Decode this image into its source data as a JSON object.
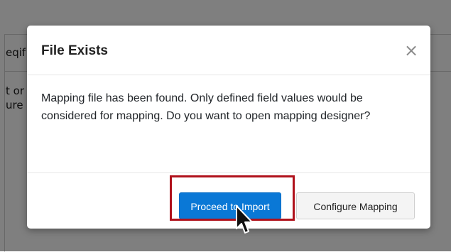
{
  "background": {
    "fragment_1": "eqif",
    "fragment_2": "t or",
    "fragment_3": "ure l"
  },
  "dialog": {
    "title": "File Exists",
    "close_symbol": "×",
    "message": "Mapping file has been found. Only defined field values would be considered for mapping. Do you want to open mapping designer?",
    "primary_button": "Proceed to Import",
    "secondary_button": "Configure Mapping"
  },
  "colors": {
    "primary": "#0a78d6",
    "highlight": "#b0111b",
    "overlay": "rgba(0,0,0,0.5)"
  },
  "icons": {
    "close": "close-icon",
    "cursor": "mouse-pointer-icon"
  }
}
